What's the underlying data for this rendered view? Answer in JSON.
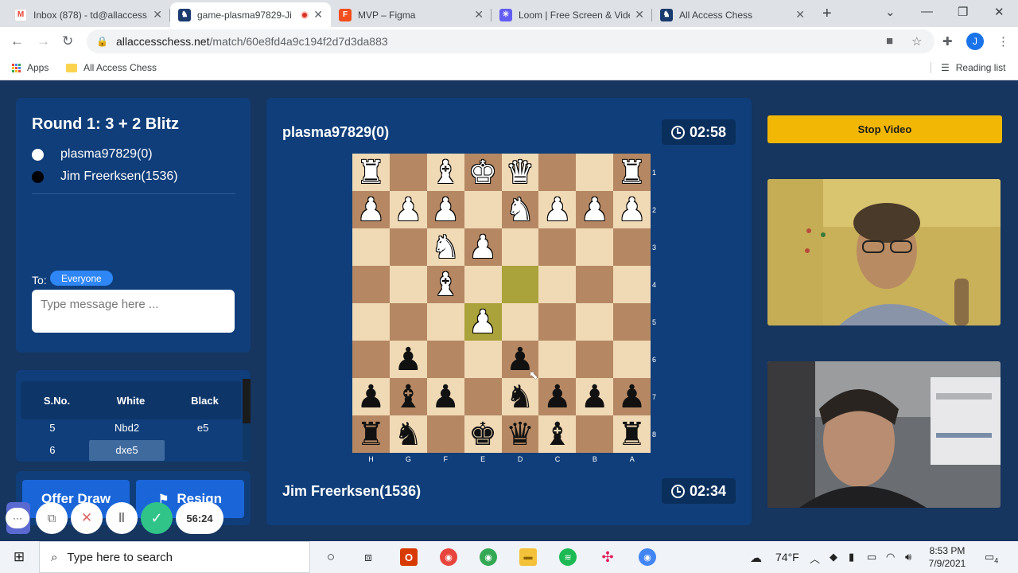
{
  "browser": {
    "tabs": [
      {
        "icon": "gmail-icon",
        "title": "Inbox (878) - td@allaccess",
        "active": false
      },
      {
        "icon": "site-icon",
        "title": "game-plasma97829-Ji",
        "active": true
      },
      {
        "icon": "figma-icon",
        "title": "MVP – Figma",
        "active": false
      },
      {
        "icon": "loom-icon",
        "title": "Loom | Free Screen & Vide",
        "active": false
      },
      {
        "icon": "site-icon",
        "title": "All Access Chess",
        "active": false
      }
    ],
    "url_host": "allaccesschess.net",
    "url_path": "/match/60e8fd4a9c194f2d7d3da883",
    "avatar_letter": "J",
    "bookmarks": {
      "apps": "Apps",
      "folder": "All Access Chess",
      "reading_list": "Reading list"
    }
  },
  "sidebar": {
    "round_title": "Round 1: 3 + 2 Blitz",
    "players": [
      {
        "color": "white",
        "name": "plasma97829(0)"
      },
      {
        "color": "black",
        "name": "Jim Freerksen(1536)"
      }
    ],
    "chat": {
      "to_label": "To:",
      "recipient": "Everyone",
      "placeholder": "Type message here ..."
    },
    "moves": {
      "headers": [
        "S.No.",
        "White",
        "Black"
      ],
      "rows": [
        {
          "no": "5",
          "white": "Nbd2",
          "black": "e5"
        },
        {
          "no": "6",
          "white": "dxe5",
          "black": ""
        }
      ]
    },
    "offer_draw": "Offer Draw",
    "resign": "Resign"
  },
  "game": {
    "top_player": "plasma97829(0)",
    "top_clock": "02:58",
    "bottom_player": "Jim Freerksen(1536)",
    "bottom_clock": "02:34",
    "rank_labels": [
      "1",
      "2",
      "3",
      "4",
      "5",
      "6",
      "7",
      "8"
    ],
    "file_labels": [
      "H",
      "G",
      "F",
      "E",
      "D",
      "C",
      "B",
      "A"
    ],
    "board": [
      [
        "wR",
        "",
        "wB",
        "wK",
        "wQ",
        "",
        "",
        "wR"
      ],
      [
        "wP",
        "wP",
        "wP",
        "",
        "wN",
        "wP",
        "wP",
        "wP"
      ],
      [
        "",
        "",
        "wN",
        "wP",
        "",
        "",
        "",
        ""
      ],
      [
        "",
        "",
        "wB",
        "",
        "",
        "",
        "",
        ""
      ],
      [
        "",
        "",
        "",
        "wP",
        "",
        "",
        "",
        ""
      ],
      [
        "",
        "bP",
        "",
        "",
        "bP",
        "",
        "",
        ""
      ],
      [
        "bP",
        "bB",
        "bP",
        "",
        "bN",
        "bP",
        "bP",
        "bP"
      ],
      [
        "bR",
        "bN",
        "",
        "bK",
        "bQ",
        "bB",
        "",
        "bR"
      ]
    ],
    "highlight_squares": [
      [
        3,
        4
      ],
      [
        4,
        3
      ]
    ]
  },
  "right": {
    "stop_video": "Stop Video"
  },
  "loom": {
    "timer": "56:24"
  },
  "taskbar": {
    "search_placeholder": "Type here to search",
    "weather": "74°F",
    "time": "8:53 PM",
    "date": "7/9/2021",
    "notifications": "4"
  }
}
